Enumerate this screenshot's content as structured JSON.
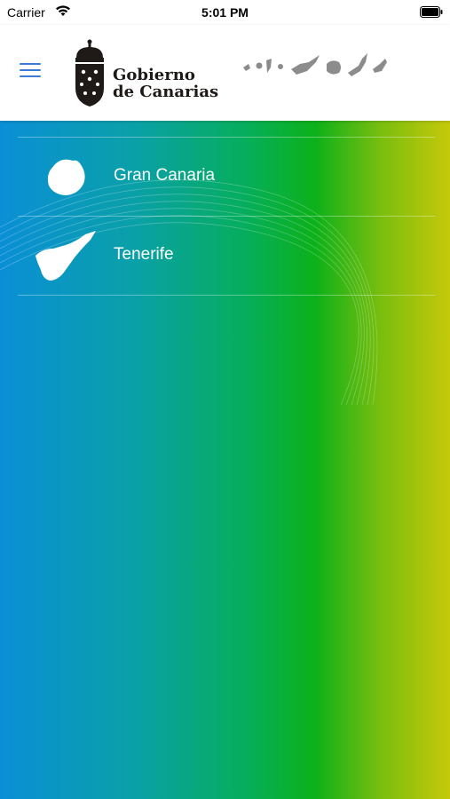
{
  "status_bar": {
    "carrier": "Carrier",
    "time": "5:01 PM"
  },
  "header": {
    "logo_line1": "Gobierno",
    "logo_line2": "de Canarias",
    "menu_icon": "hamburger-menu-icon",
    "accent_color": "#3b7bd6"
  },
  "islands": [
    {
      "label": "Gran Canaria",
      "icon": "gran-canaria-icon"
    },
    {
      "label": "Tenerife",
      "icon": "tenerife-icon"
    }
  ],
  "colors": {
    "gradient": [
      "#0a8fd6",
      "#06ae5a",
      "#0cb11a",
      "#c5c90a"
    ]
  }
}
